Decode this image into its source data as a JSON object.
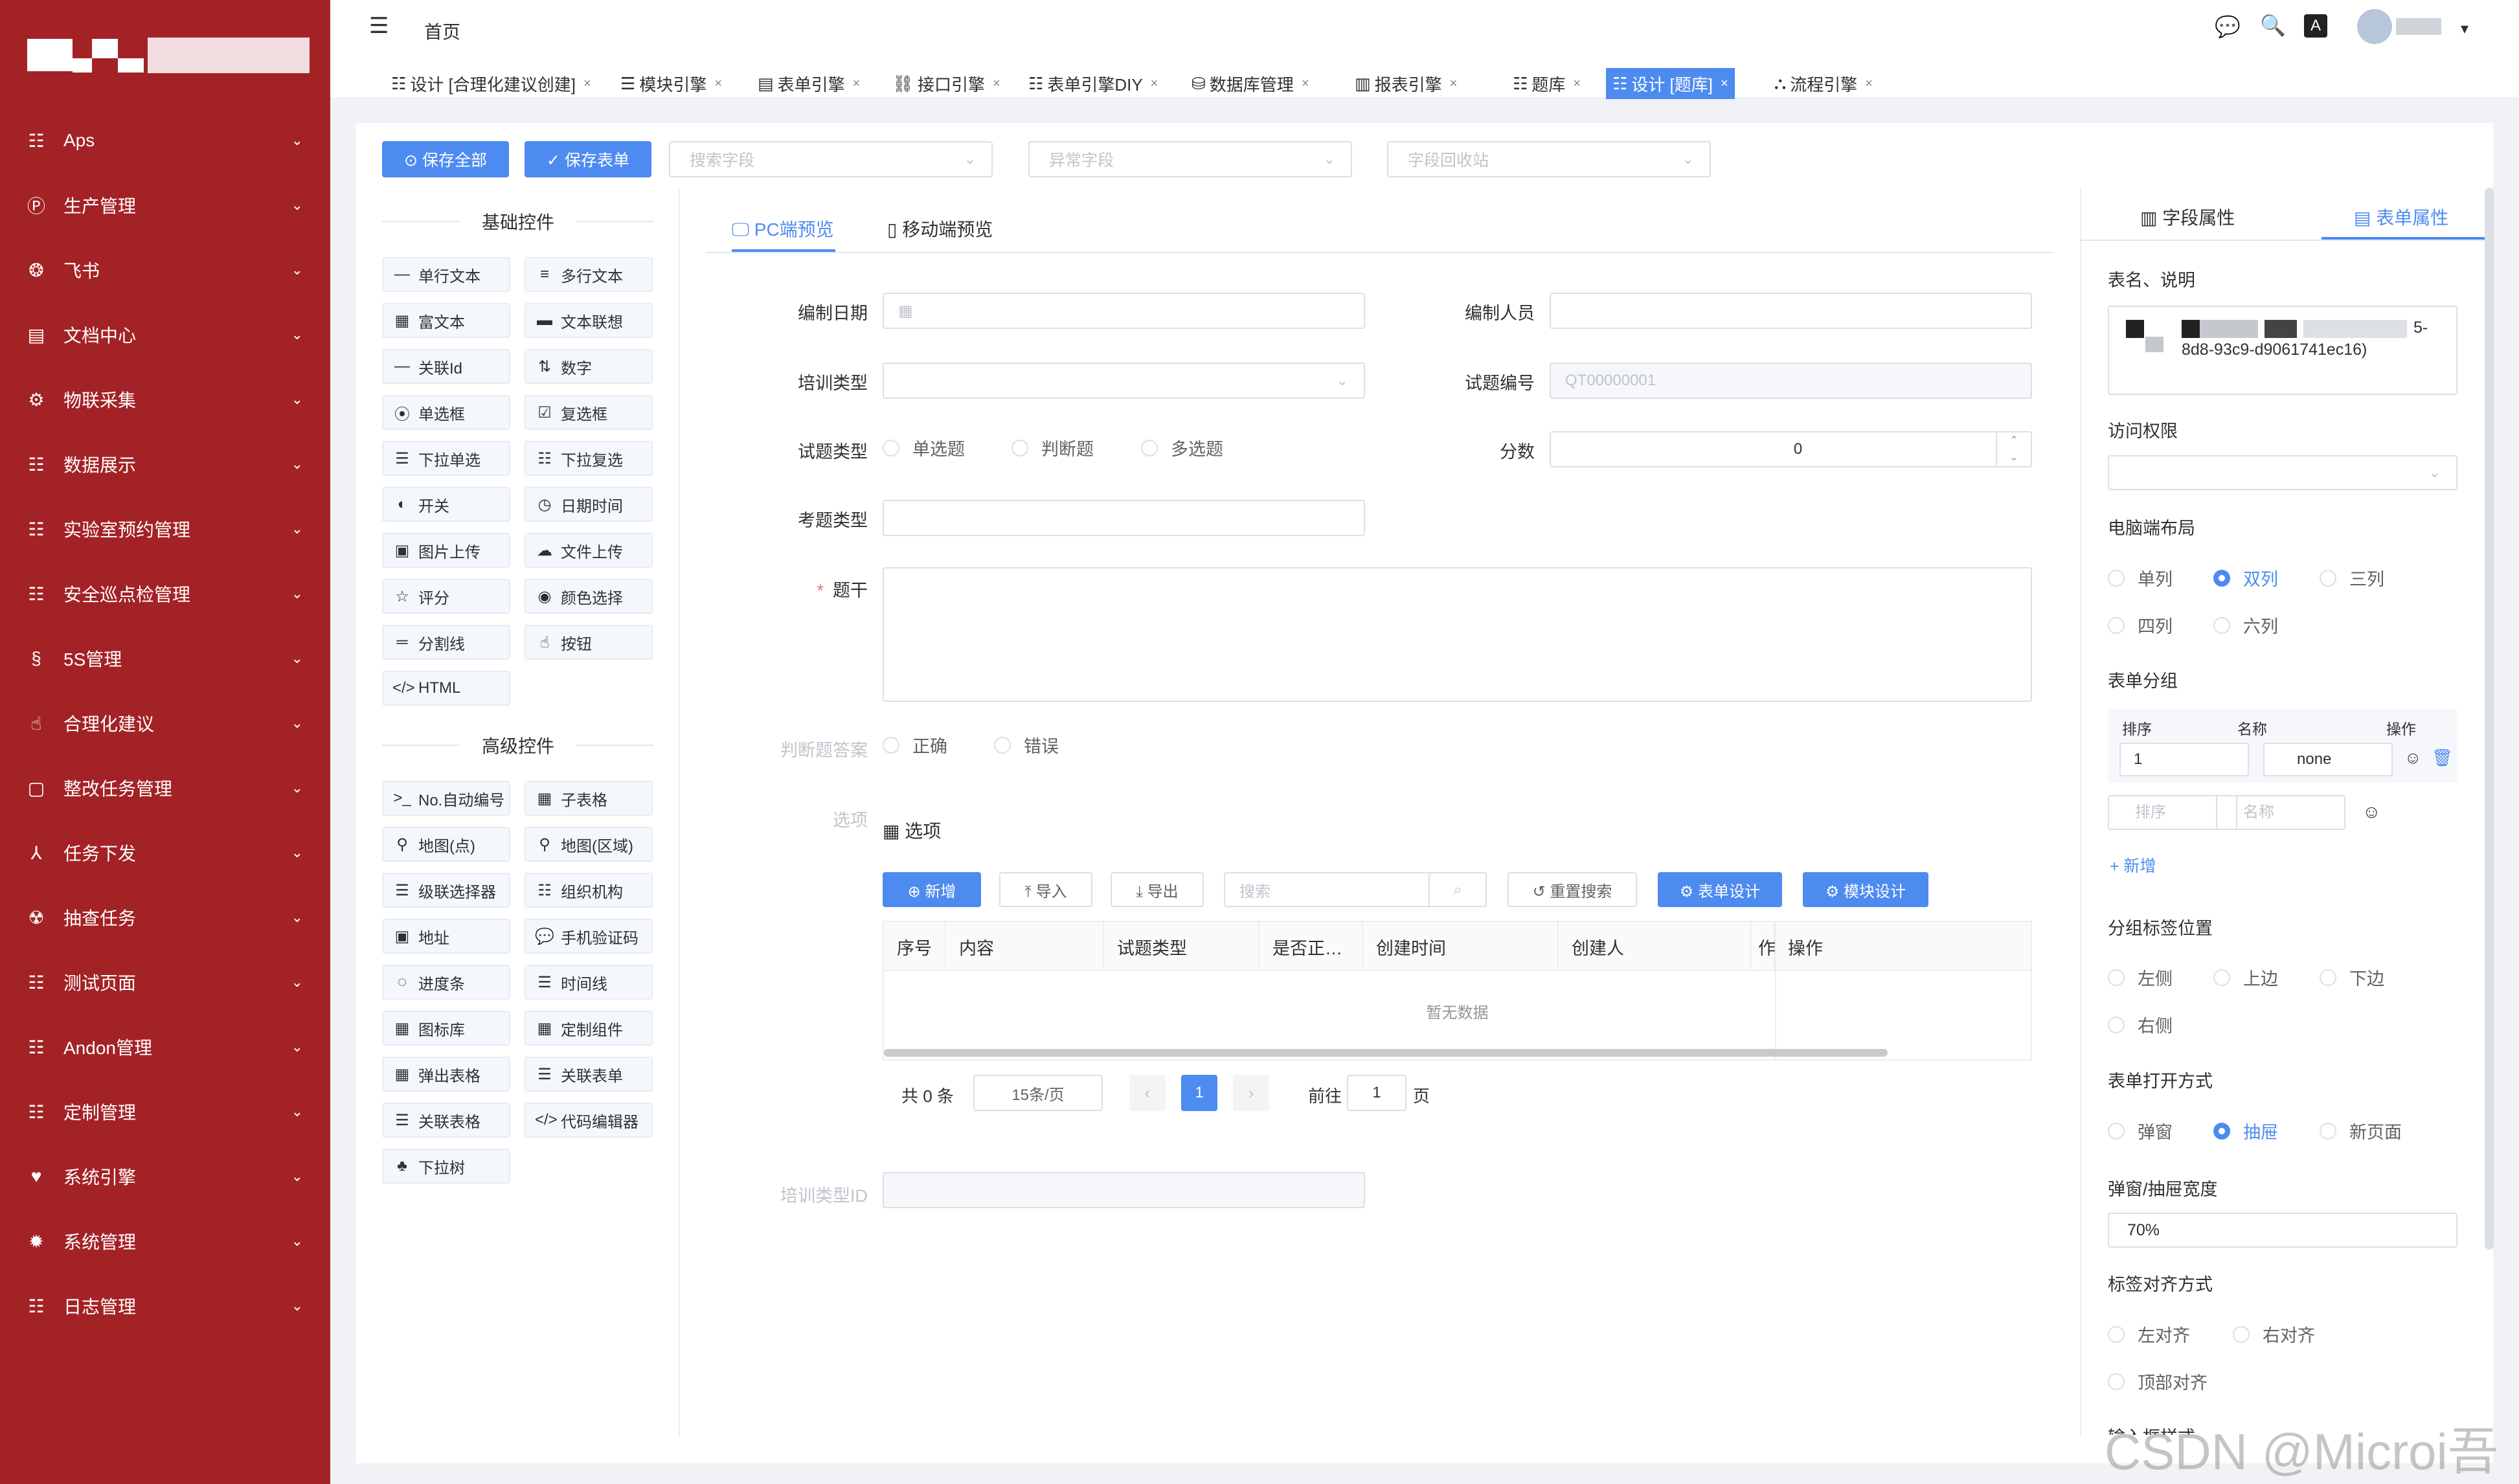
{
  "sidebar": {
    "items": [
      {
        "icon": "☷",
        "label": "Aps"
      },
      {
        "icon": "Ⓟ",
        "label": "生产管理"
      },
      {
        "icon": "❂",
        "label": "飞书"
      },
      {
        "icon": "▤",
        "label": "文档中心"
      },
      {
        "icon": "⚙",
        "label": "物联采集"
      },
      {
        "icon": "☷",
        "label": "数据展示"
      },
      {
        "icon": "☷",
        "label": "实验室预约管理"
      },
      {
        "icon": "☷",
        "label": "安全巡点检管理"
      },
      {
        "icon": "§",
        "label": "5S管理"
      },
      {
        "icon": "☝",
        "label": "合理化建议"
      },
      {
        "icon": "▢",
        "label": "整改任务管理"
      },
      {
        "icon": "⅄",
        "label": "任务下发"
      },
      {
        "icon": "☢",
        "label": "抽查任务"
      },
      {
        "icon": "☷",
        "label": "测试页面"
      },
      {
        "icon": "☷",
        "label": "Andon管理"
      },
      {
        "icon": "☷",
        "label": "定制管理"
      },
      {
        "icon": "♥",
        "label": "系统引擎"
      },
      {
        "icon": "✹",
        "label": "系统管理"
      },
      {
        "icon": "☷",
        "label": "日志管理"
      }
    ],
    "chevron": "⌄"
  },
  "header": {
    "menu_icon": "☰",
    "breadcrumb": "首页",
    "icons": [
      "💬",
      "🔍",
      "A",
      "▾"
    ]
  },
  "tabs": [
    {
      "icon": "☷",
      "label": "设计 [合理化建议创建]"
    },
    {
      "icon": "☰",
      "label": "模块引擎"
    },
    {
      "icon": "▤",
      "label": "表单引擎"
    },
    {
      "icon": "⛓",
      "label": "接口引擎"
    },
    {
      "icon": "☷",
      "label": "表单引擎DIY"
    },
    {
      "icon": "⛁",
      "label": "数据库管理"
    },
    {
      "icon": "▥",
      "label": "报表引擎"
    },
    {
      "icon": "☷",
      "label": "题库"
    },
    {
      "icon": "☷",
      "label": "设计 [题库]"
    },
    {
      "icon": "⛬",
      "label": "流程引擎"
    }
  ],
  "tab_close": "×",
  "toolbar": {
    "save_all": "⊙ 保存全部",
    "save_form": "✓ 保存表单",
    "search_field": "搜索字段",
    "abnormal_field": "异常字段",
    "recycle_bin": "字段回收站"
  },
  "palette": {
    "basic_title": "基础控件",
    "basic": [
      {
        "icon": "—",
        "label": "单行文本"
      },
      {
        "icon": "≡",
        "label": "多行文本"
      },
      {
        "icon": "▦",
        "label": "富文本"
      },
      {
        "icon": "▬",
        "label": "文本联想"
      },
      {
        "icon": "—",
        "label": "关联Id"
      },
      {
        "icon": "⇅",
        "label": "数字"
      },
      {
        "icon": "⦿",
        "label": "单选框"
      },
      {
        "icon": "☑",
        "label": "复选框"
      },
      {
        "icon": "☰",
        "label": "下拉单选"
      },
      {
        "icon": "☷",
        "label": "下拉复选"
      },
      {
        "icon": "◐",
        "label": "开关"
      },
      {
        "icon": "◷",
        "label": "日期时间"
      },
      {
        "icon": "▣",
        "label": "图片上传"
      },
      {
        "icon": "☁",
        "label": "文件上传"
      },
      {
        "icon": "☆",
        "label": "评分"
      },
      {
        "icon": "◉",
        "label": "颜色选择"
      },
      {
        "icon": "═",
        "label": "分割线"
      },
      {
        "icon": "☝",
        "label": "按钮"
      },
      {
        "icon": "</>",
        "label": "HTML"
      }
    ],
    "adv_title": "高级控件",
    "advanced": [
      {
        "icon": ">_",
        "label": "No.自动编号"
      },
      {
        "icon": "▦",
        "label": "子表格"
      },
      {
        "icon": "⚲",
        "label": "地图(点)"
      },
      {
        "icon": "⚲",
        "label": "地图(区域)"
      },
      {
        "icon": "☰",
        "label": "级联选择器"
      },
      {
        "icon": "☷",
        "label": "组织机构"
      },
      {
        "icon": "▣",
        "label": "地址"
      },
      {
        "icon": "💬",
        "label": "手机验证码"
      },
      {
        "icon": "◌",
        "label": "进度条"
      },
      {
        "icon": "☰",
        "label": "时间线"
      },
      {
        "icon": "▦",
        "label": "图标库"
      },
      {
        "icon": "▦",
        "label": "定制组件"
      },
      {
        "icon": "▦",
        "label": "弹出表格"
      },
      {
        "icon": "☰",
        "label": "关联表单"
      },
      {
        "icon": "☰",
        "label": "关联表格"
      },
      {
        "icon": "</>",
        "label": "代码编辑器"
      },
      {
        "icon": "♣",
        "label": "下拉树"
      }
    ]
  },
  "preview": {
    "pc_tab": "🖵 PC端预览",
    "mobile_tab": "▯ 移动端预览"
  },
  "form": {
    "date_label": "编制日期",
    "creator_label": "编制人员",
    "train_label": "培训类型",
    "code_label": "试题编号",
    "code_value": "QT00000001",
    "qtype_label": "试题类型",
    "qtype_options": [
      "单选题",
      "判断题",
      "多选题"
    ],
    "score_label": "分数",
    "score_value": "0",
    "kind_label": "考题类型",
    "stem_label": "题干",
    "required_mark": "*",
    "tf_label": "判断题答案",
    "tf_options": [
      "正确",
      "错误"
    ],
    "options_label": "选项",
    "options_title": "▦ 选项",
    "train_id_label": "培训类型ID"
  },
  "subtable": {
    "buttons": [
      "⊕ 新增",
      "⤒ 导入",
      "⤓ 导出"
    ],
    "search_placeholder": "搜索",
    "reset": "↺ 重置搜索",
    "form_design": "⚙ 表单设计",
    "module_design": "⚙ 模块设计",
    "columns": [
      "序号",
      "内容",
      "试题类型",
      "是否正…",
      "创建时间",
      "创建人",
      "作",
      "操作"
    ],
    "empty": "暂无数据",
    "total": "共 0 条",
    "page_size": "15条/页",
    "current_page": "1",
    "goto": "前往",
    "goto_value": "1",
    "page_unit": "页"
  },
  "props": {
    "field_tab": "▥ 字段属性",
    "form_tab": "▤ 表单属性",
    "name_title": "表名、说明",
    "name_value": "8d8-93c9-d9061741ec16)",
    "name_prefix": "5-",
    "access_title": "访问权限",
    "layout_title": "电脑端布局",
    "layout_options": [
      "单列",
      "双列",
      "三列",
      "四列",
      "六列"
    ],
    "group_title": "表单分组",
    "group_columns": [
      "排序",
      "名称",
      "操作"
    ],
    "group_row": {
      "order": "1",
      "name": "none"
    },
    "group_new": {
      "order_ph": "排序",
      "name_ph": "名称"
    },
    "add": "+ 新增",
    "tagpos_title": "分组标签位置",
    "tagpos_options": [
      "左侧",
      "上边",
      "下边",
      "右侧"
    ],
    "open_title": "表单打开方式",
    "open_options": [
      "弹窗",
      "抽屉",
      "新页面"
    ],
    "width_title": "弹窗/抽屉宽度",
    "width_value": "70%",
    "align_title": "标签对齐方式",
    "align_options": [
      "左对齐",
      "右对齐",
      "顶部对齐"
    ],
    "cut_title": "输入框样式"
  },
  "watermark": "CSDN @Microi吾码"
}
